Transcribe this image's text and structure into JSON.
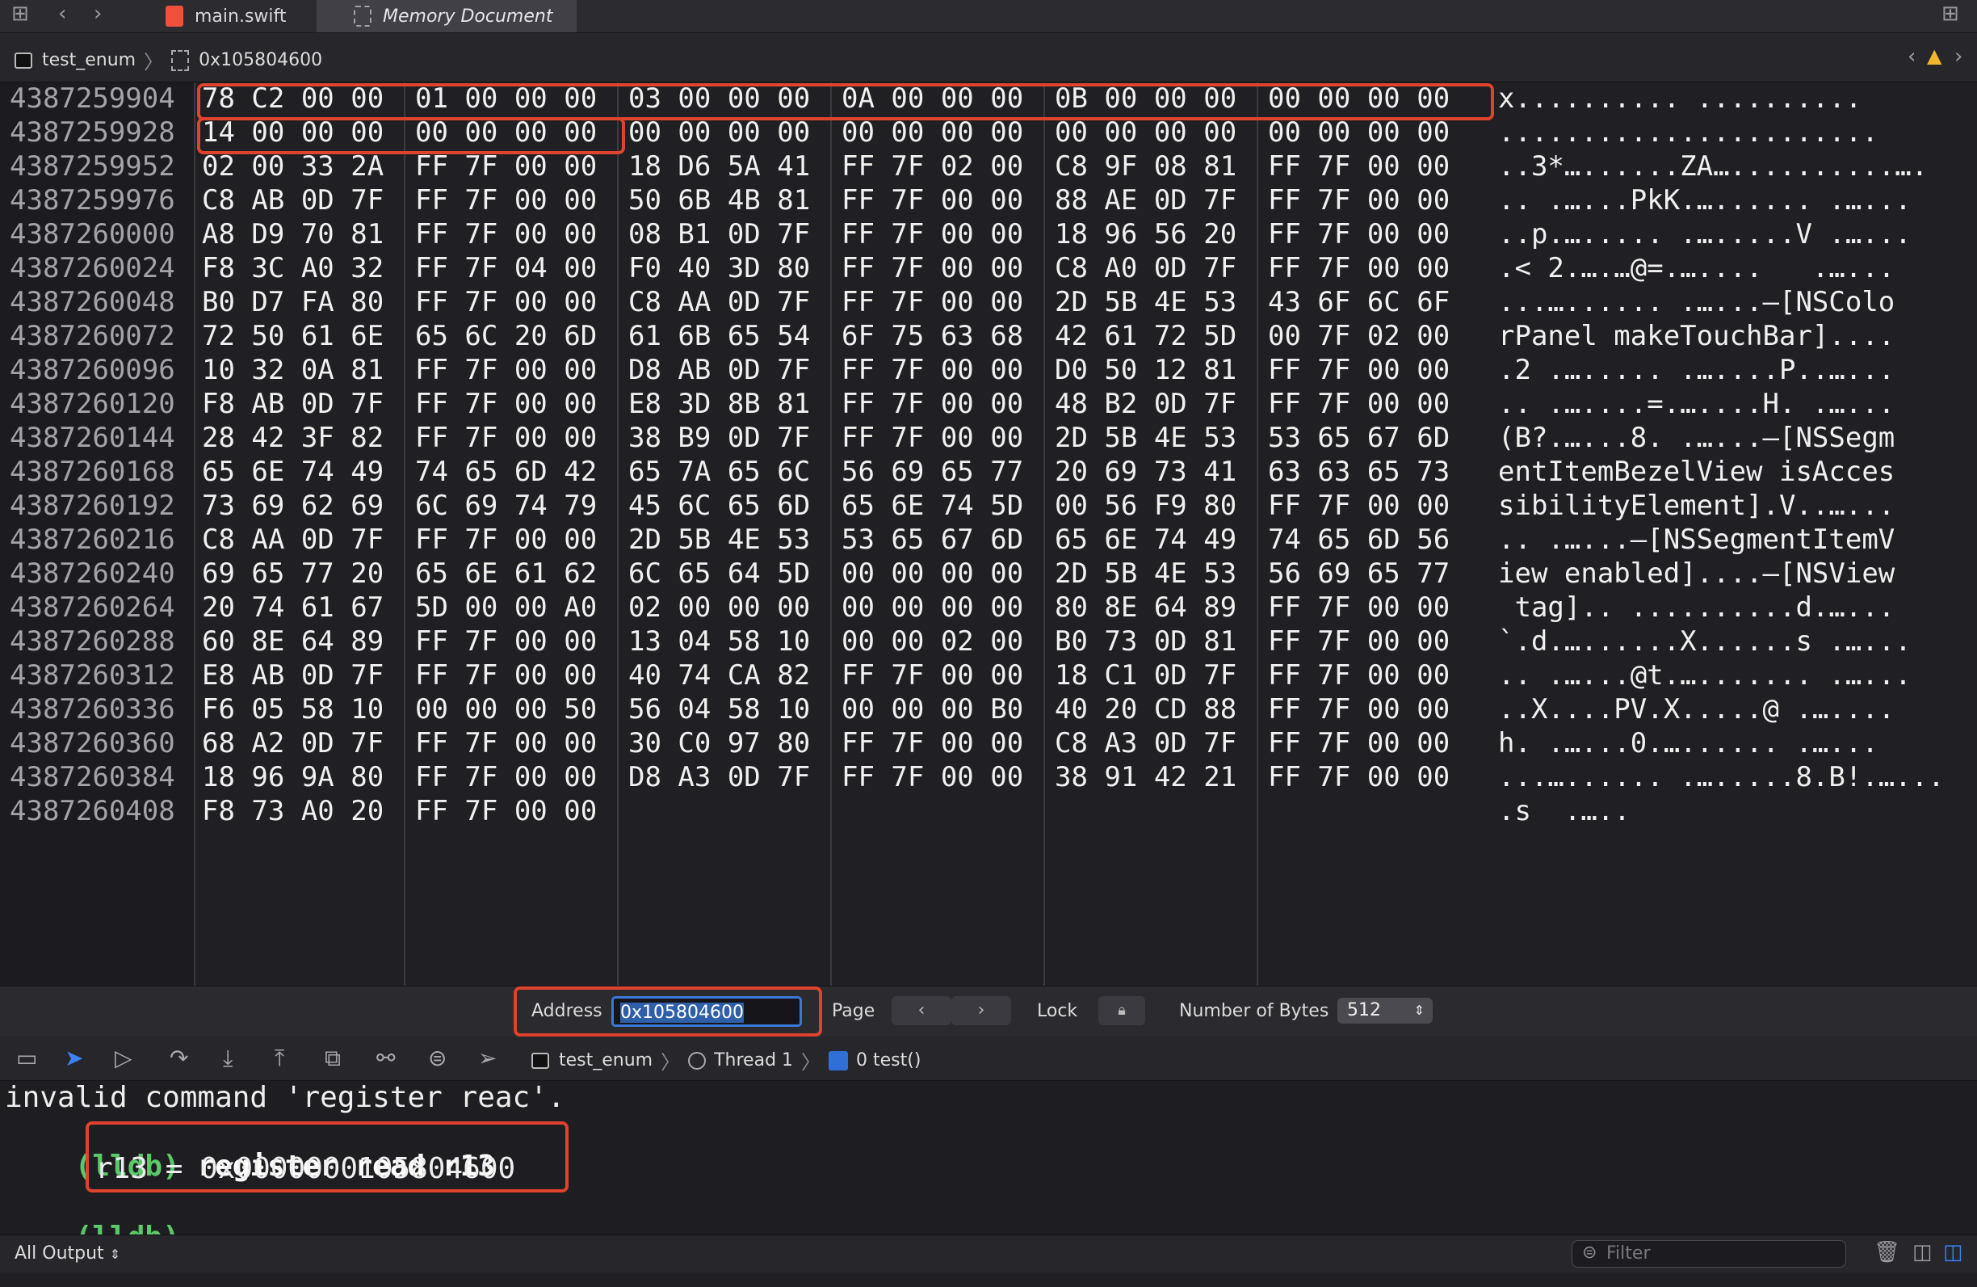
{
  "tabs": [
    {
      "label": "main.swift"
    },
    {
      "label": "Memory Document"
    }
  ],
  "breadcrumb": {
    "target": "test_enum",
    "address": "0x105804600"
  },
  "memory": {
    "rows": [
      {
        "addr": "4387259904",
        "hex": [
          "78 C2 00 00",
          "01 00 00 00",
          "03 00 00 00",
          "0A 00 00 00",
          "0B 00 00 00",
          "00 00 00 00"
        ],
        "ascii": "x.......... .........."
      },
      {
        "addr": "4387259928",
        "hex": [
          "14 00 00 00",
          "00 00 00 00",
          "00 00 00 00",
          "00 00 00 00",
          "00 00 00 00",
          "00 00 00 00"
        ],
        "ascii": "......................."
      },
      {
        "addr": "4387259952",
        "hex": [
          "02 00 33 2A",
          "FF 7F 00 00",
          "18 D6 5A 41",
          "FF 7F 02 00",
          "C8 9F 08 81",
          "FF 7F 00 00"
        ],
        "ascii": "..3*…......ZA…..........…."
      },
      {
        "addr": "4387259976",
        "hex": [
          "C8 AB 0D 7F",
          "FF 7F 00 00",
          "50 6B 4B 81",
          "FF 7F 00 00",
          "88 AE 0D 7F",
          "FF 7F 00 00"
        ],
        "ascii": ".. .…...PkK.…...... .…..."
      },
      {
        "addr": "4387260000",
        "hex": [
          "A8 D9 70 81",
          "FF 7F 00 00",
          "08 B1 0D 7F",
          "FF 7F 00 00",
          "18 96 56 20",
          "FF 7F 00 00"
        ],
        "ascii": "..p.…..... .….....V .…..."
      },
      {
        "addr": "4387260024",
        "hex": [
          "F8 3C A0 32",
          "FF 7F 04 00",
          "F0 40 3D 80",
          "FF 7F 00 00",
          "C8 A0 0D 7F",
          "FF 7F 00 00"
        ],
        "ascii": ".< 2.….…@=.…....   .…..."
      },
      {
        "addr": "4387260048",
        "hex": [
          "B0 D7 FA 80",
          "FF 7F 00 00",
          "C8 AA 0D 7F",
          "FF 7F 00 00",
          "2D 5B 4E 53",
          "43 6F 6C 6F"
        ],
        "ascii": "...…...... .…...–[NSColo"
      },
      {
        "addr": "4387260072",
        "hex": [
          "72 50 61 6E",
          "65 6C 20 6D",
          "61 6B 65 54",
          "6F 75 63 68",
          "42 61 72 5D",
          "00 7F 02 00"
        ],
        "ascii": "rPanel makeTouchBar]...."
      },
      {
        "addr": "4387260096",
        "hex": [
          "10 32 0A 81",
          "FF 7F 00 00",
          "D8 AB 0D 7F",
          "FF 7F 00 00",
          "D0 50 12 81",
          "FF 7F 00 00"
        ],
        "ascii": ".2 .…..... .…....P..…..."
      },
      {
        "addr": "4387260120",
        "hex": [
          "F8 AB 0D 7F",
          "FF 7F 00 00",
          "E8 3D 8B 81",
          "FF 7F 00 00",
          "48 B2 0D 7F",
          "FF 7F 00 00"
        ],
        "ascii": ".. .…....=.…....H. .…..."
      },
      {
        "addr": "4387260144",
        "hex": [
          "28 42 3F 82",
          "FF 7F 00 00",
          "38 B9 0D 7F",
          "FF 7F 00 00",
          "2D 5B 4E 53",
          "53 65 67 6D"
        ],
        "ascii": "(B?.…...8. .…...–[NSSegm"
      },
      {
        "addr": "4387260168",
        "hex": [
          "65 6E 74 49",
          "74 65 6D 42",
          "65 7A 65 6C",
          "56 69 65 77",
          "20 69 73 41",
          "63 63 65 73"
        ],
        "ascii": "entItemBezelView isAcces"
      },
      {
        "addr": "4387260192",
        "hex": [
          "73 69 62 69",
          "6C 69 74 79",
          "45 6C 65 6D",
          "65 6E 74 5D",
          "00 56 F9 80",
          "FF 7F 00 00"
        ],
        "ascii": "sibilityElement].V..…..."
      },
      {
        "addr": "4387260216",
        "hex": [
          "C8 AA 0D 7F",
          "FF 7F 00 00",
          "2D 5B 4E 53",
          "53 65 67 6D",
          "65 6E 74 49",
          "74 65 6D 56"
        ],
        "ascii": ".. .…...–[NSSegmentItemV"
      },
      {
        "addr": "4387260240",
        "hex": [
          "69 65 77 20",
          "65 6E 61 62",
          "6C 65 64 5D",
          "00 00 00 00",
          "2D 5B 4E 53",
          "56 69 65 77"
        ],
        "ascii": "iew enabled]....–[NSView"
      },
      {
        "addr": "4387260264",
        "hex": [
          "20 74 61 67",
          "5D 00 00 A0",
          "02 00 00 00",
          "00 00 00 00",
          "80 8E 64 89",
          "FF 7F 00 00"
        ],
        "ascii": " tag].. ..........d.…..."
      },
      {
        "addr": "4387260288",
        "hex": [
          "60 8E 64 89",
          "FF 7F 00 00",
          "13 04 58 10",
          "00 00 02 00",
          "B0 73 0D 81",
          "FF 7F 00 00"
        ],
        "ascii": "`.d.…......X......s .…..."
      },
      {
        "addr": "4387260312",
        "hex": [
          "E8 AB 0D 7F",
          "FF 7F 00 00",
          "40 74 CA 82",
          "FF 7F 00 00",
          "18 C1 0D 7F",
          "FF 7F 00 00"
        ],
        "ascii": ".. .…...@t.…....... .…..."
      },
      {
        "addr": "4387260336",
        "hex": [
          "F6 05 58 10",
          "00 00 00 50",
          "56 04 58 10",
          "00 00 00 B0",
          "40 20 CD 88",
          "FF 7F 00 00"
        ],
        "ascii": "..X....PV.X.....@ .…...."
      },
      {
        "addr": "4387260360",
        "hex": [
          "68 A2 0D 7F",
          "FF 7F 00 00",
          "30 C0 97 80",
          "FF 7F 00 00",
          "C8 A3 0D 7F",
          "FF 7F 00 00"
        ],
        "ascii": "h. .…...0.…...... .…..."
      },
      {
        "addr": "4387260384",
        "hex": [
          "18 96 9A 80",
          "FF 7F 00 00",
          "D8 A3 0D 7F",
          "FF 7F 00 00",
          "38 91 42 21",
          "FF 7F 00 00"
        ],
        "ascii": "...…...... .….....8.B!.…..."
      },
      {
        "addr": "4387260408",
        "hex": [
          "F8 73 A0 20",
          "FF 7F 00 00",
          "",
          "",
          "",
          ""
        ],
        "ascii": ".s  .….."
      }
    ]
  },
  "controls": {
    "address_label": "Address",
    "address_value": "0x105804600",
    "page_label": "Page",
    "lock_label": "Lock",
    "bytes_label": "Number of Bytes",
    "bytes_value": "512"
  },
  "debug": {
    "target": "test_enum",
    "thread": "Thread 1",
    "frame": "0 test()"
  },
  "console": {
    "line1": "invalid command 'register reac'.",
    "prompt": "(lldb)",
    "command": "register read r13",
    "result": "r13 = 0x0000000105804600"
  },
  "bottom": {
    "output_selector": "All Output",
    "filter_placeholder": "Filter"
  }
}
